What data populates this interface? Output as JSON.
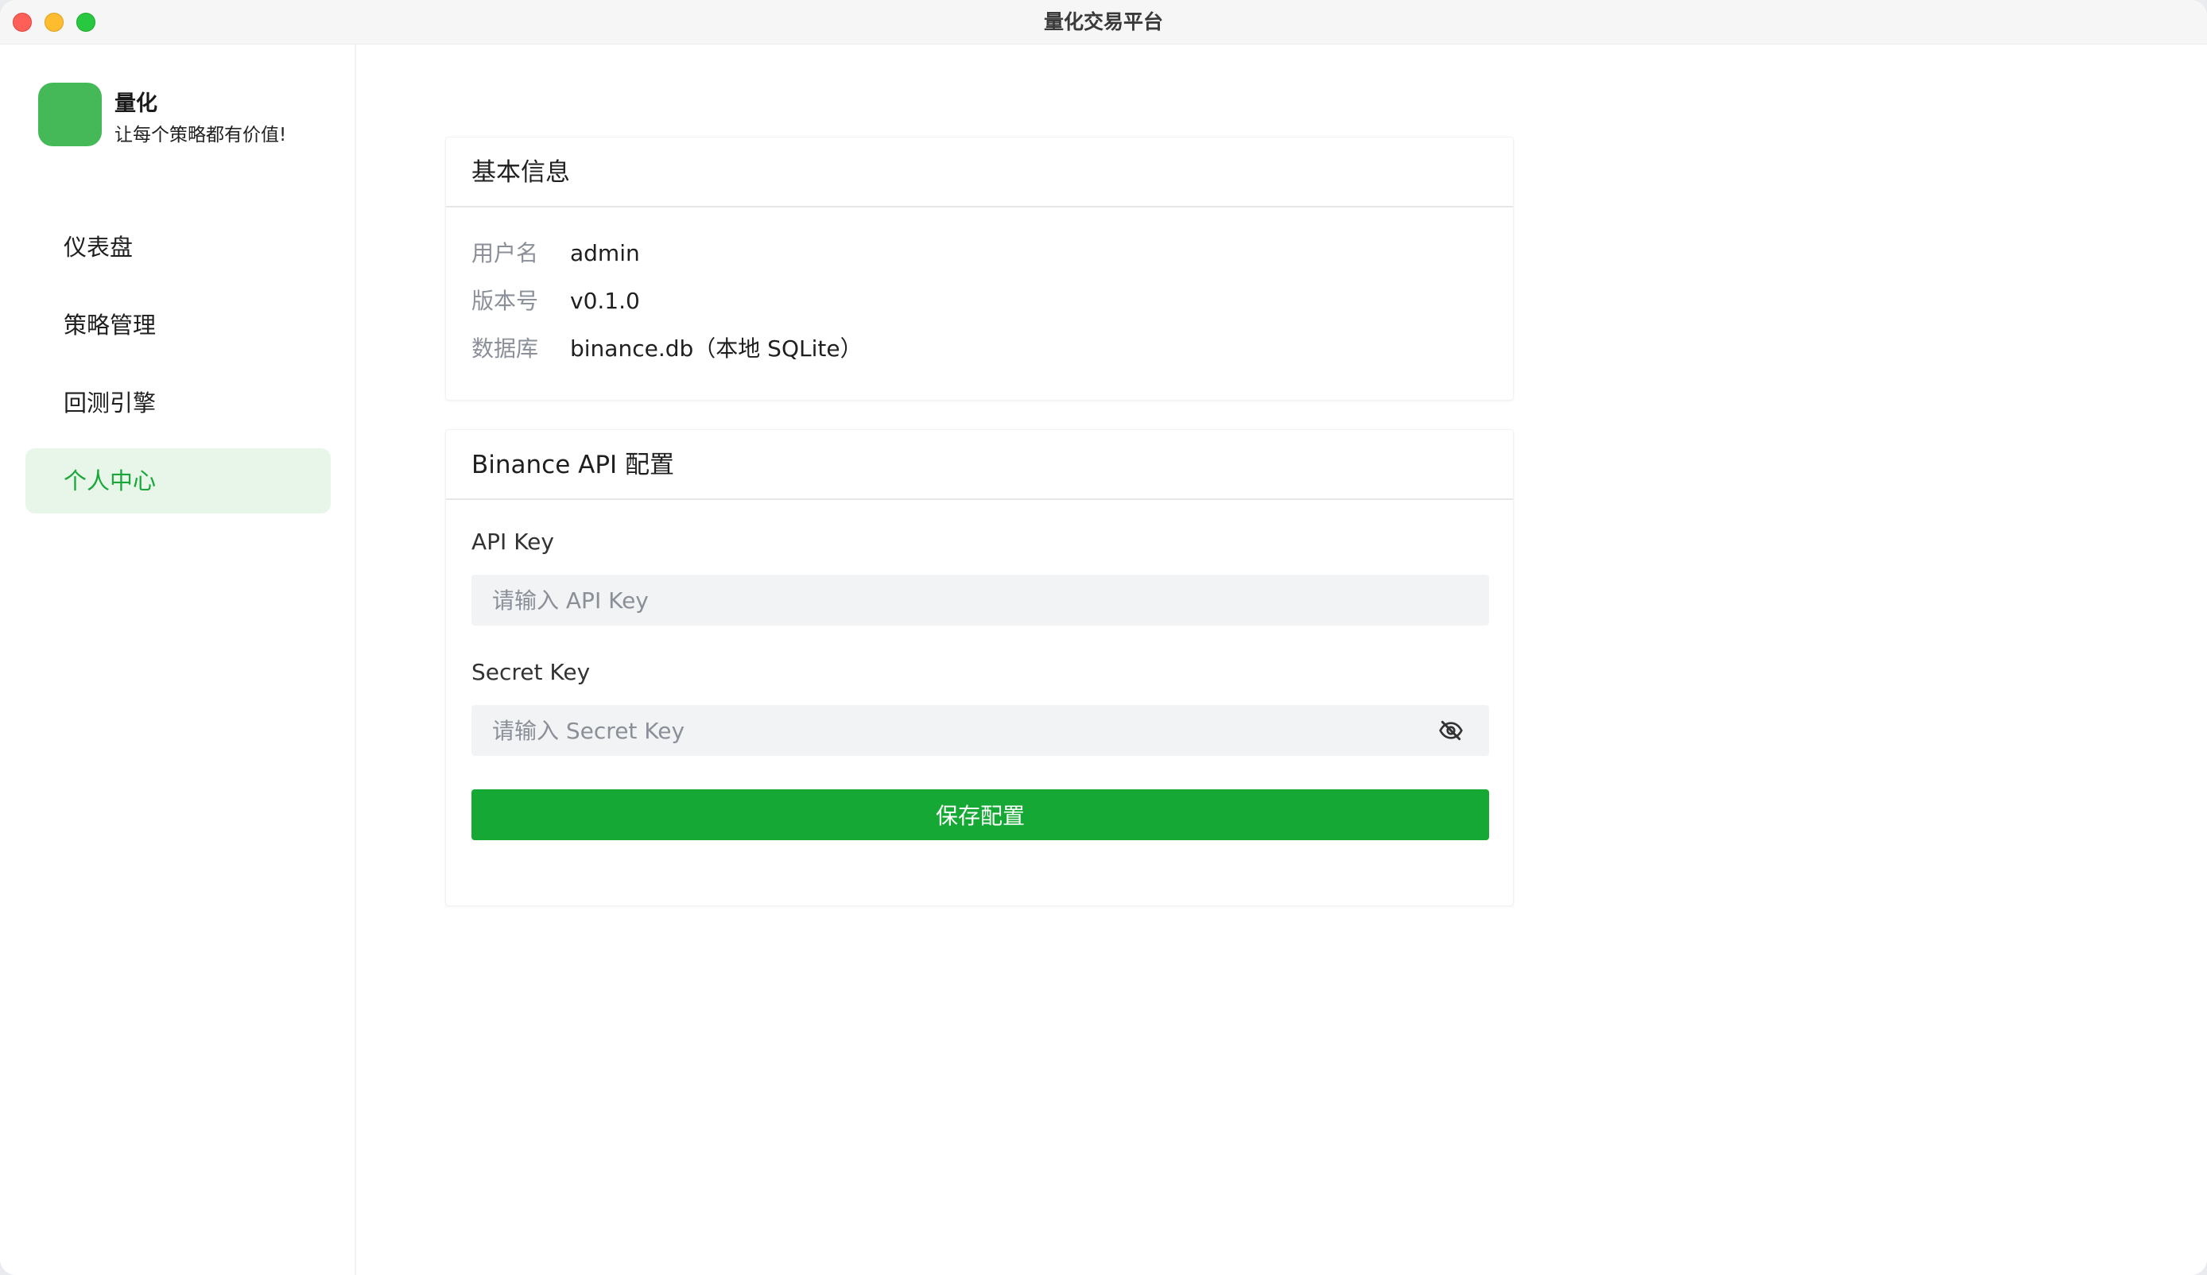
{
  "window": {
    "title": "量化交易平台"
  },
  "brand": {
    "name": "量化",
    "slogan": "让每个策略都有价值!",
    "logo_color": "#45b957"
  },
  "sidebar": {
    "items": [
      {
        "label": "仪表盘",
        "active": false
      },
      {
        "label": "策略管理",
        "active": false
      },
      {
        "label": "回测引擎",
        "active": false
      },
      {
        "label": "个人中心",
        "active": true
      }
    ]
  },
  "basic_info": {
    "title": "基本信息",
    "rows": [
      {
        "key": "用户名",
        "value": "admin"
      },
      {
        "key": "版本号",
        "value": "v0.1.0"
      },
      {
        "key": "数据库",
        "value": "binance.db（本地 SQLite）"
      }
    ]
  },
  "api_config": {
    "title": "Binance API 配置",
    "api_key": {
      "label": "API Key",
      "value": "",
      "placeholder": "请输入 API Key"
    },
    "secret_key": {
      "label": "Secret Key",
      "value": "",
      "placeholder": "请输入 Secret Key",
      "icon": "eye-off-icon"
    },
    "save_label": "保存配置"
  },
  "colors": {
    "accent": "#16a834",
    "active_bg": "#e8f6ea",
    "active_text": "#1aa63b"
  }
}
